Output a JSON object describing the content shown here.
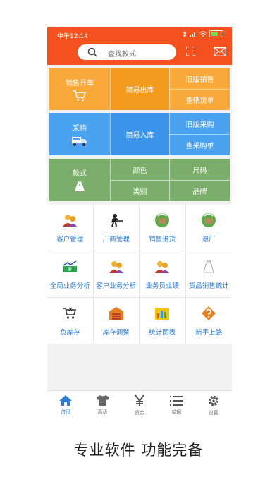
{
  "status_bar": {
    "time": "中午12:14"
  },
  "search": {
    "placeholder": "查找款式"
  },
  "sales_block": {
    "main": "销售开单",
    "middle": "简易出库",
    "top_right": "旧版销售",
    "bottom_right": "查销货单"
  },
  "purchase_block": {
    "main": "采购",
    "middle": "简易入库",
    "top_right": "旧版采购",
    "bottom_right": "查采购单"
  },
  "style_block": {
    "main": "款式",
    "color": "颜色",
    "size": "尺码",
    "category": "类别",
    "brand": "品牌"
  },
  "grid": [
    {
      "label": "客户管理",
      "icon": "people-icon"
    },
    {
      "label": "厂商管理",
      "icon": "worker-icon"
    },
    {
      "label": "销售退货",
      "icon": "return-icon"
    },
    {
      "label": "退厂",
      "icon": "return-factory-icon"
    },
    {
      "label": "全局业务分析",
      "icon": "money-chart-icon"
    },
    {
      "label": "客户业务分析",
      "icon": "people-icon"
    },
    {
      "label": "业务员业绩",
      "icon": "people-icon"
    },
    {
      "label": "货品销售统计",
      "icon": "dress-icon"
    },
    {
      "label": "负库存",
      "icon": "cart-x-icon"
    },
    {
      "label": "库存调整",
      "icon": "warehouse-icon"
    },
    {
      "label": "统计图表",
      "icon": "bar-chart-icon"
    },
    {
      "label": "新手上路",
      "icon": "help-icon"
    }
  ],
  "tabs": [
    {
      "label": "首页",
      "icon": "home-icon",
      "active": true
    },
    {
      "label": "高级",
      "icon": "shirt-icon"
    },
    {
      "label": "资金",
      "icon": "yen-icon"
    },
    {
      "label": "单据",
      "icon": "list-icon"
    },
    {
      "label": "设置",
      "icon": "gear-icon"
    }
  ],
  "caption": "专业软件  功能完备",
  "colors": {
    "header": "#f4511e",
    "sales": "#f9a83a",
    "purchase": "#4aa2f0",
    "style": "#7bad6b",
    "link": "#2e7dd1"
  }
}
